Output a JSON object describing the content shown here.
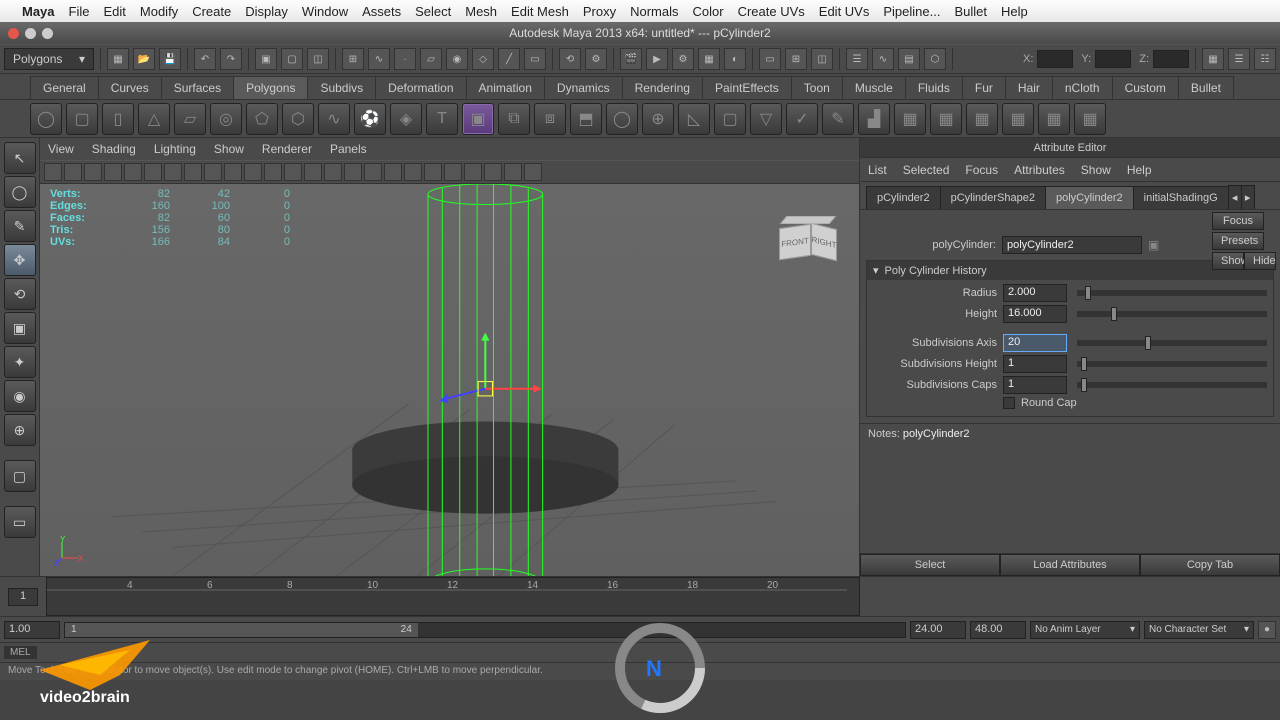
{
  "macmenu": {
    "app": "Maya",
    "items": [
      "File",
      "Edit",
      "Modify",
      "Create",
      "Display",
      "Window",
      "Assets",
      "Select",
      "Mesh",
      "Edit Mesh",
      "Proxy",
      "Normals",
      "Color",
      "Create UVs",
      "Edit UVs",
      "Pipeline...",
      "Bullet",
      "Help"
    ]
  },
  "window": {
    "title": "Autodesk Maya 2013 x64: untitled*   ---   pCylinder2"
  },
  "traffic": {
    "close": "#e4564a",
    "min": "#e0e0e0",
    "max": "#e0e0e0"
  },
  "moduleDropdown": "Polygons",
  "coords": {
    "x": "X:",
    "y": "Y:",
    "z": "Z:"
  },
  "moduleTabs": [
    "General",
    "Curves",
    "Surfaces",
    "Polygons",
    "Subdivs",
    "Deformation",
    "Animation",
    "Dynamics",
    "Rendering",
    "PaintEffects",
    "Toon",
    "Muscle",
    "Fluids",
    "Fur",
    "Hair",
    "nCloth",
    "Custom",
    "Bullet"
  ],
  "moduleTabActive": 3,
  "viewportMenu": [
    "View",
    "Shading",
    "Lighting",
    "Show",
    "Renderer",
    "Panels"
  ],
  "hudStats": [
    {
      "label": "Verts:",
      "a": "82",
      "b": "42",
      "c": "0"
    },
    {
      "label": "Edges:",
      "a": "160",
      "b": "100",
      "c": "0"
    },
    {
      "label": "Faces:",
      "a": "82",
      "b": "60",
      "c": "0"
    },
    {
      "label": "Tris:",
      "a": "156",
      "b": "80",
      "c": "0"
    },
    {
      "label": "UVs:",
      "a": "166",
      "b": "84",
      "c": "0"
    }
  ],
  "viewcube": {
    "front": "FRONT",
    "right": "RIGHT"
  },
  "attrEditor": {
    "title": "Attribute Editor",
    "menu": [
      "List",
      "Selected",
      "Focus",
      "Attributes",
      "Show",
      "Help"
    ],
    "tabs": [
      "pCylinder2",
      "pCylinderShape2",
      "polyCylinder2",
      "initialShadingG"
    ],
    "tabActive": 2,
    "nodeTypeLabel": "polyCylinder:",
    "nodeName": "polyCylinder2",
    "sideBtns": {
      "focus": "Focus",
      "presets": "Presets",
      "show": "Show",
      "hide": "Hide"
    },
    "sectionTitle": "Poly Cylinder History",
    "fields": {
      "radius": {
        "label": "Radius",
        "value": "2.000",
        "thumb": 4
      },
      "height": {
        "label": "Height",
        "value": "16.000",
        "thumb": 18
      },
      "subdivAxis": {
        "label": "Subdivisions Axis",
        "value": "20",
        "thumb": 36
      },
      "subdivHeight": {
        "label": "Subdivisions Height",
        "value": "1",
        "thumb": 2
      },
      "subdivCaps": {
        "label": "Subdivisions Caps",
        "value": "1",
        "thumb": 2
      },
      "roundCap": {
        "label": "Round Cap"
      }
    },
    "notesLabel": "Notes:",
    "notesValue": "polyCylinder2",
    "bottomBtns": [
      "Select",
      "Load Attributes",
      "Copy Tab"
    ]
  },
  "timeline": {
    "start": "1",
    "ticks": [
      "4",
      "6",
      "8",
      "10",
      "12",
      "14",
      "16",
      "18",
      "20"
    ],
    "rangeLabel1": "1"
  },
  "range": {
    "startOuter": "1.00",
    "startInner": "1",
    "curInner": "24",
    "endOuter": "24.00",
    "endEnd": "48.00",
    "animLayer": "No Anim Layer",
    "charSet": "No Character Set"
  },
  "cmd": {
    "lang": "MEL"
  },
  "help": "Move Tool: Use manipulator to move object(s). Use edit mode to change pivot (HOME). Ctrl+LMB to move perpendicular.",
  "watermark": "video2brain"
}
